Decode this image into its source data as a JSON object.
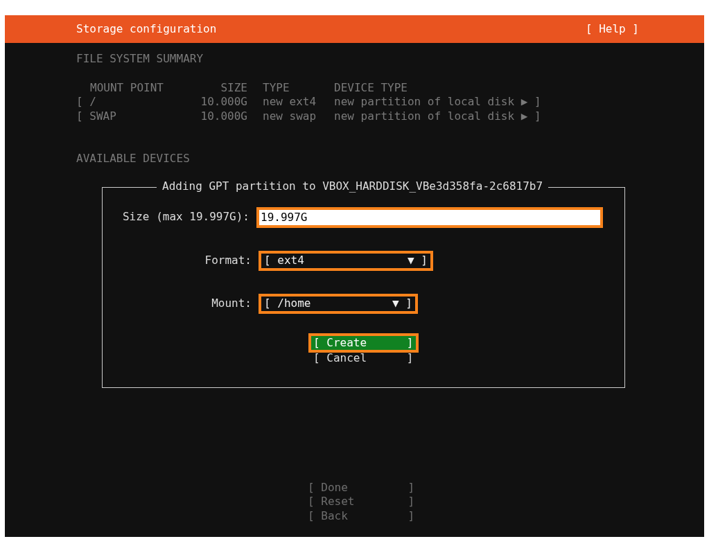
{
  "header": {
    "title": "Storage configuration",
    "help": "[ Help ]"
  },
  "summary": {
    "heading": "FILE SYSTEM SUMMARY",
    "columns": [
      "MOUNT POINT",
      "SIZE",
      "TYPE",
      "DEVICE TYPE"
    ],
    "rows": [
      {
        "mount": "[ /",
        "size": "10.000G",
        "type": "new ext4",
        "device_type": "new partition of local disk ▶ ]"
      },
      {
        "mount": "[ SWAP",
        "size": "10.000G",
        "type": "new swap",
        "device_type": "new partition of local disk ▶ ]"
      }
    ]
  },
  "devices_heading": "AVAILABLE DEVICES",
  "dialog": {
    "title": "Adding GPT partition to VBOX_HARDDISK_VBe3d358fa-2c6817b7",
    "fields": [
      {
        "kind": "input",
        "label": "Size (max 19.997G):",
        "value": "19.997G",
        "highlighted": true
      },
      {
        "kind": "dropdown",
        "label": "Format:",
        "value": "[ ext4",
        "arrow": "▼ ]",
        "highlighted": true
      },
      {
        "kind": "dropdown",
        "label": "Mount:",
        "value": "[ /home",
        "arrow": "▼ ]",
        "highlighted": true
      }
    ],
    "buttons": [
      {
        "label": "[ Create      ]",
        "focused": true,
        "highlighted": true
      },
      {
        "label": "[ Cancel      ]",
        "focused": false,
        "highlighted": false
      }
    ]
  },
  "footer_buttons": [
    "[ Done         ]",
    "[ Reset        ]",
    "[ Back         ]"
  ]
}
